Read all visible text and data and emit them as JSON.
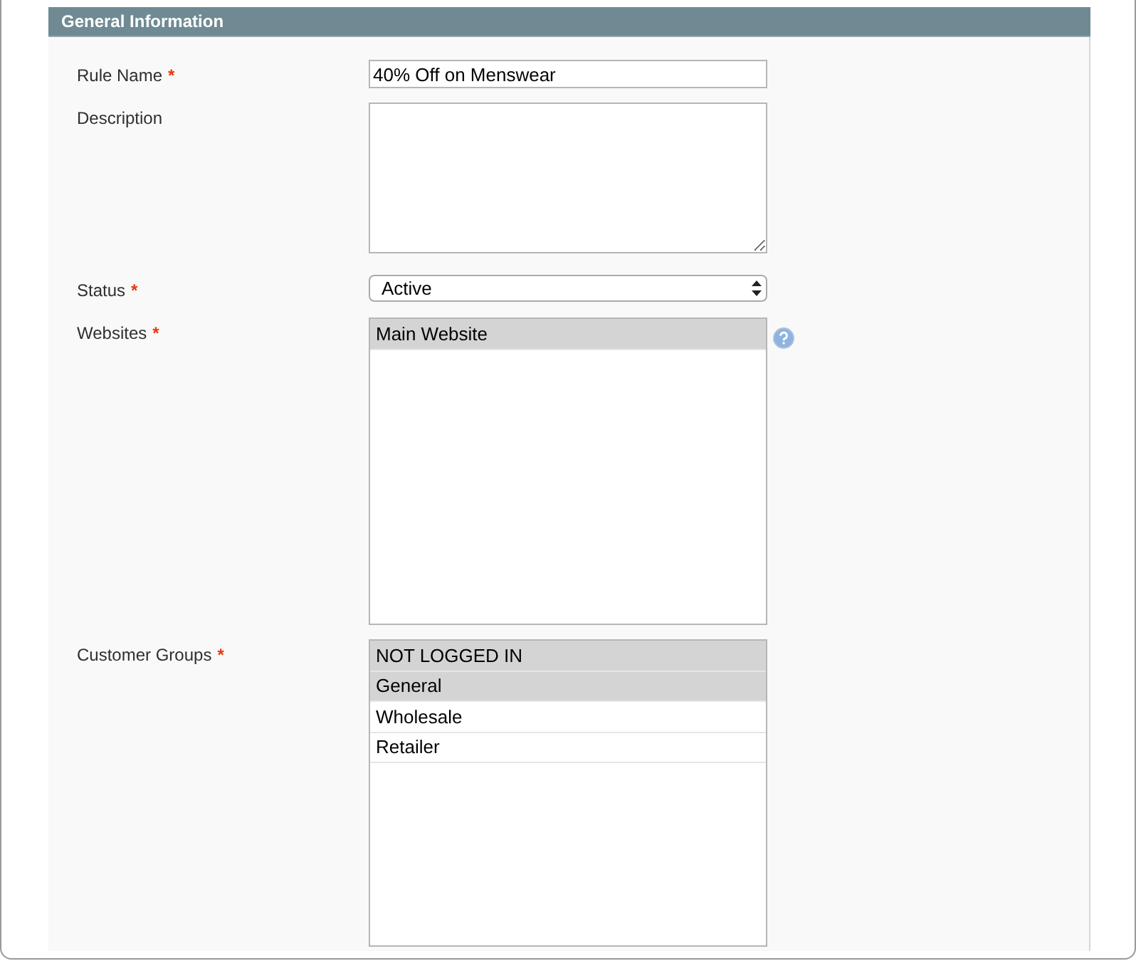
{
  "section_title": "General Information",
  "fields": [
    {
      "kind": "text",
      "label": "Rule Name",
      "required_mark": "*",
      "value": "40% Off on Menswear"
    },
    {
      "kind": "textarea",
      "label": "Description"
    },
    {
      "kind": "select",
      "label": "Status",
      "required_mark": "*",
      "value": "Active"
    },
    {
      "kind": "multiselect",
      "label": "Websites",
      "required_mark": "*",
      "help": true,
      "options": [
        {
          "label": "Main Website",
          "selected": true
        }
      ]
    },
    {
      "kind": "multiselect",
      "label": "Customer Groups",
      "required_mark": "*",
      "help": false,
      "options": [
        {
          "label": "NOT LOGGED IN",
          "selected": true
        },
        {
          "label": "General",
          "selected": true
        },
        {
          "label": "Wholesale",
          "selected": false
        },
        {
          "label": "Retailer",
          "selected": false
        }
      ]
    }
  ]
}
